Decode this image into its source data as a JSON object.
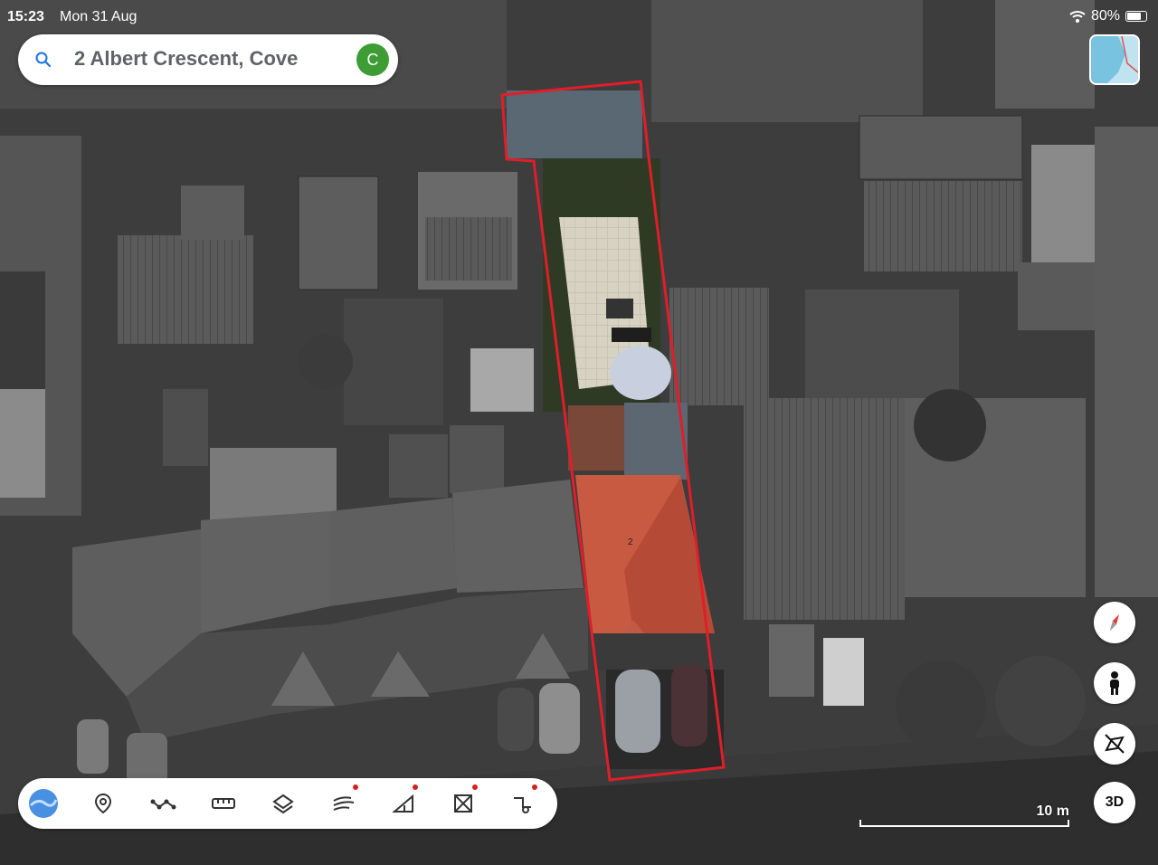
{
  "status": {
    "time": "15:23",
    "date": "Mon 31 Aug",
    "battery": "80%",
    "battery_level": 0.8,
    "wifi_icon": "wifi-icon"
  },
  "search": {
    "text": "2 Albert Crescent, Cove",
    "icon": "search-icon"
  },
  "account": {
    "initial": "C",
    "color": "#3e9c35"
  },
  "map": {
    "house_number": "2",
    "boundary_color": "#e01e2a",
    "scale_label": "10 m"
  },
  "controls": {
    "compass": "compass-icon",
    "street_view": "pegman-icon",
    "tilt": "tilt-icon",
    "view_3d": "3D"
  },
  "toolbar": {
    "items": [
      {
        "name": "earth-icon",
        "has_dot": false
      },
      {
        "name": "location-pin-icon",
        "has_dot": false
      },
      {
        "name": "path-icon",
        "has_dot": false
      },
      {
        "name": "ruler-icon",
        "has_dot": false
      },
      {
        "name": "layers-icon",
        "has_dot": false
      },
      {
        "name": "wind-icon",
        "has_dot": true
      },
      {
        "name": "elevation-icon",
        "has_dot": true
      },
      {
        "name": "area-icon",
        "has_dot": true
      },
      {
        "name": "measure-icon",
        "has_dot": true
      }
    ],
    "dot_color": "#d62020"
  }
}
